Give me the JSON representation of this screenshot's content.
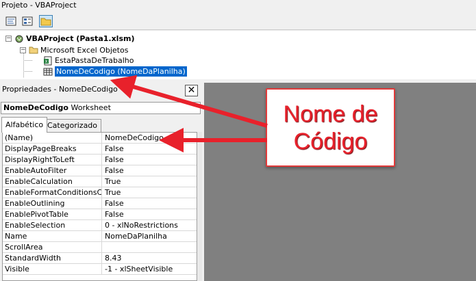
{
  "project": {
    "title": "Projeto - VBAProject",
    "toolbar": {
      "view_code_icon": "view-code-icon",
      "view_object_icon": "view-object-icon",
      "toggle_folders_icon": "folder-icon"
    },
    "tree": {
      "root": "VBAProject (Pasta1.xlsm)",
      "folder": "Microsoft Excel Objetos",
      "items": [
        "EstaPastaDeTrabalho",
        "NomeDeCodigo (NomeDaPlanilha)"
      ],
      "selected_index": 1
    }
  },
  "properties": {
    "title": "Propriedades - NomeDeCodigo",
    "close_label": "✕",
    "object_name": "NomeDeCodigo",
    "object_type": "Worksheet",
    "tabs": [
      "Alfabético",
      "Categorizado"
    ],
    "active_tab": 0,
    "rows": [
      {
        "name": "(Name)",
        "value": "NomeDeCodigo"
      },
      {
        "name": "DisplayPageBreaks",
        "value": "False"
      },
      {
        "name": "DisplayRightToLeft",
        "value": "False"
      },
      {
        "name": "EnableAutoFilter",
        "value": "False"
      },
      {
        "name": "EnableCalculation",
        "value": "True"
      },
      {
        "name": "EnableFormatConditionsCalcu",
        "value": "True"
      },
      {
        "name": "EnableOutlining",
        "value": "False"
      },
      {
        "name": "EnablePivotTable",
        "value": "False"
      },
      {
        "name": "EnableSelection",
        "value": "0 - xlNoRestrictions"
      },
      {
        "name": "Name",
        "value": "NomeDaPlanilha"
      },
      {
        "name": "ScrollArea",
        "value": ""
      },
      {
        "name": "StandardWidth",
        "value": "8.43"
      },
      {
        "name": "Visible",
        "value": "-1 - xlSheetVisible"
      }
    ]
  },
  "callout": {
    "line1": "Nome de",
    "line2": "Código",
    "color": "#e8212b"
  },
  "colors": {
    "selection": "#0066cc",
    "code_area": "#808080",
    "accent_red": "#e23a3a"
  }
}
